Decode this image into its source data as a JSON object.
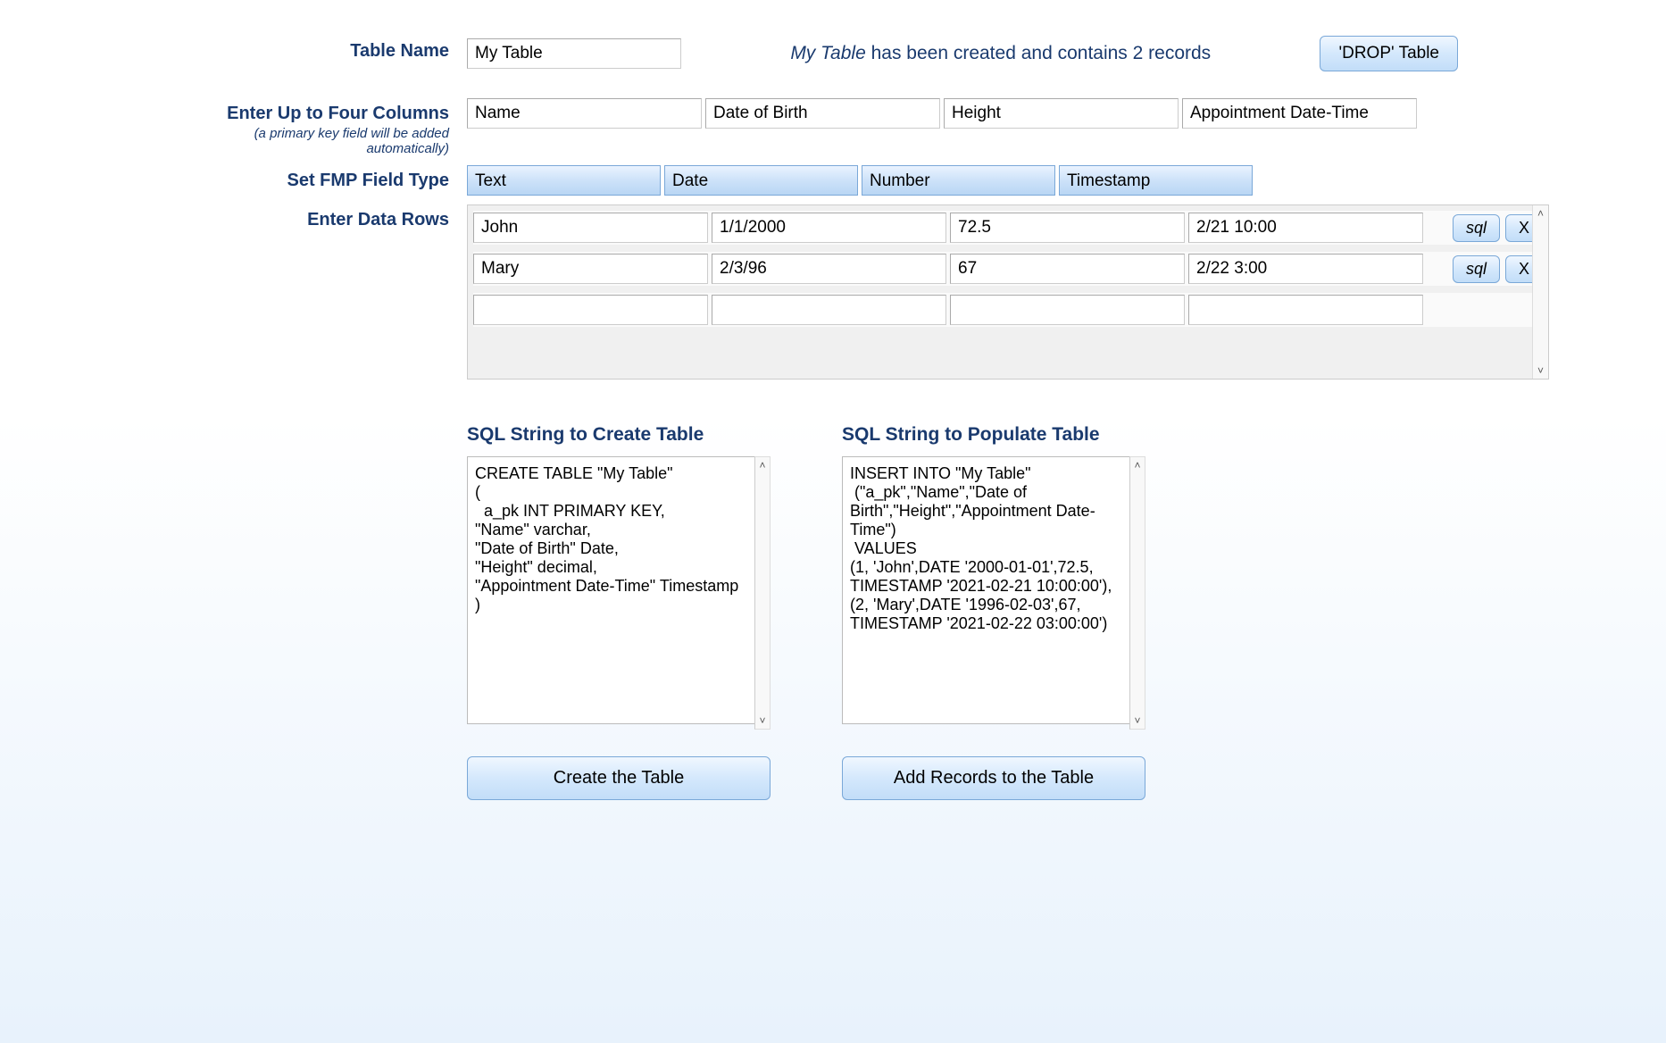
{
  "labels": {
    "table_name": "Table Name",
    "columns": "Enter Up to Four Columns",
    "columns_sub": "(a primary key field will be added automatically)",
    "field_type": "Set  FMP Field Type",
    "data_rows": "Enter Data Rows"
  },
  "table_name_value": "My Table",
  "status": {
    "prefix_italic": "My Table",
    "rest": " has been created and contains 2 records"
  },
  "buttons": {
    "drop": "'DROP' Table",
    "sql": "sql",
    "x": "X",
    "create_table": "Create the Table",
    "add_records": "Add Records to the Table"
  },
  "columns": [
    "Name",
    "Date of Birth",
    "Height",
    "Appointment Date-Time"
  ],
  "types": [
    "Text",
    "Date",
    "Number",
    "Timestamp"
  ],
  "rows": [
    {
      "c0": "John",
      "c1": "1/1/2000",
      "c2": "72.5",
      "c3": "2/21 10:00"
    },
    {
      "c0": "Mary",
      "c1": "2/3/96",
      "c2": "67",
      "c3": "2/22 3:00"
    },
    {
      "c0": "",
      "c1": "",
      "c2": "",
      "c3": ""
    }
  ],
  "sql_create": {
    "heading": "SQL String to Create Table",
    "text": "CREATE TABLE \"My Table\"\n(\n  a_pk INT PRIMARY KEY,\n\"Name\" varchar,\n\"Date of Birth\" Date,\n\"Height\" decimal,\n\"Appointment Date-Time\" Timestamp\n)"
  },
  "sql_insert": {
    "heading": "SQL String to Populate Table",
    "text": "INSERT INTO \"My Table\"\n (\"a_pk\",\"Name\",\"Date of Birth\",\"Height\",\"Appointment Date-Time\")\n VALUES\n(1, 'John',DATE '2000-01-01',72.5, TIMESTAMP '2021-02-21 10:00:00'),\n(2, 'Mary',DATE '1996-02-03',67, TIMESTAMP '2021-02-22 03:00:00')"
  },
  "scroll": {
    "up": "˄",
    "down": "˅"
  }
}
